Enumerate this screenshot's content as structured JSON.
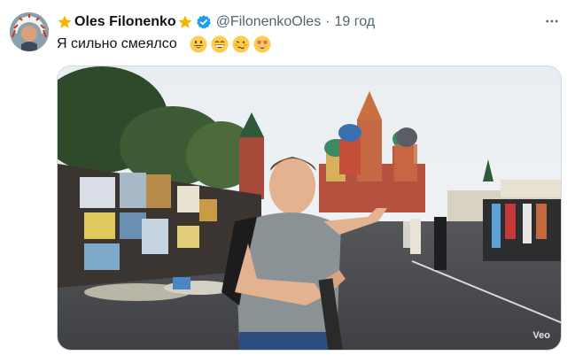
{
  "tweet": {
    "author_name": "Oles Filonenko",
    "handle": "@FilonenkoOles",
    "separator": "·",
    "time": "19 год",
    "text": "Я сильно смеялсо",
    "emojis": [
      "grinning-face",
      "beaming-face",
      "woozy-face",
      "star-struck-face"
    ]
  },
  "media": {
    "watermark": "Veo",
    "description_icon": "video-frame"
  },
  "colors": {
    "verified": "#1d9bf0",
    "star": "#f7b500",
    "secondary_text": "#536471"
  },
  "icons": {
    "more": "more-horizontal-icon",
    "verified": "verified-badge-icon",
    "star": "star-icon"
  }
}
